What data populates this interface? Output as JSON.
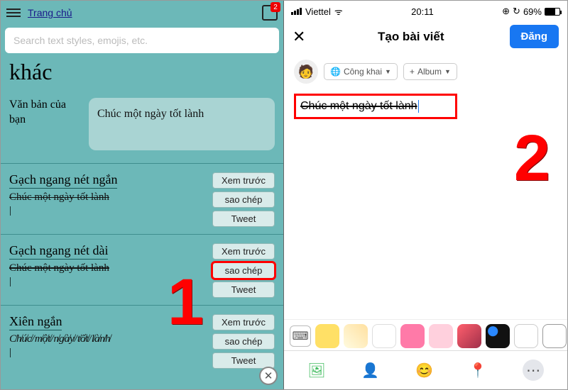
{
  "left": {
    "home_link": "Trang chủ",
    "notif_badge": "2",
    "search_placeholder": "Search text styles, emojis, etc.",
    "big_word": "khác",
    "your_text_label": "Văn bản của bạn",
    "your_text_value": "Chúc một ngày tốt lành",
    "styles": [
      {
        "title": "Gạch ngang nét ngắn",
        "sample": "Chúc một ngày tốt lành",
        "buttons": {
          "preview": "Xem trước",
          "copy": "sao chép",
          "tweet": "Tweet"
        }
      },
      {
        "title": "Gạch ngang nét dài",
        "sample": "Chúc một ngày tốt lành",
        "buttons": {
          "preview": "Xem trước",
          "copy": "sao chép",
          "tweet": "Tweet"
        }
      },
      {
        "title": "Xiên ngắn",
        "sample": "C̸h̸ú̸c̸/m̸ộ̸t̸/n̸g̸à̸y̸/t̸ố̸t̸/l̸à̸n̸h̸",
        "buttons": {
          "preview": "Xem trước",
          "copy": "sao chép",
          "tweet": "Tweet"
        }
      }
    ],
    "annotation_num": "1"
  },
  "right": {
    "status": {
      "carrier": "Viettel",
      "time": "20:11",
      "alarm": "⊙",
      "battery_pct": "69%"
    },
    "header": {
      "close": "✕",
      "title": "Tạo bài viết",
      "post": "Đăng"
    },
    "meta": {
      "audience_icon": "🌐",
      "audience": "Công khai",
      "album_plus": "+",
      "album": "Album"
    },
    "compose_text": "Chúc một ngày tốt lành",
    "annotation_num": "2",
    "bg_swatches": [
      {
        "name": "keyboard",
        "css": ""
      },
      {
        "name": "emoji-yellow",
        "css": "background:#ffe066;"
      },
      {
        "name": "pattern",
        "css": "background:linear-gradient(45deg,#fffbe0,#ffe0a0);"
      },
      {
        "name": "blank",
        "css": "background:#fff;border:1px solid #ddd;"
      },
      {
        "name": "pink",
        "css": "background:#ff7aa8;"
      },
      {
        "name": "heart",
        "css": "background:#ffd0dd;"
      },
      {
        "name": "red-grad",
        "css": "background:linear-gradient(135deg,#ff5f6d,#a0304a);"
      },
      {
        "name": "dark",
        "css": "background:radial-gradient(circle at 30% 30%,#2a88ff 0 20%,#111 22% 100%);"
      },
      {
        "name": "rings",
        "css": "background:#fff;border:1px solid #ccc;"
      },
      {
        "name": "grid",
        "css": "background:#fff;border:1px solid #999;"
      }
    ],
    "actions": {
      "photo": "🖼",
      "tag": "👤",
      "feeling": "😊",
      "location": "📍",
      "more": "⋯"
    }
  }
}
